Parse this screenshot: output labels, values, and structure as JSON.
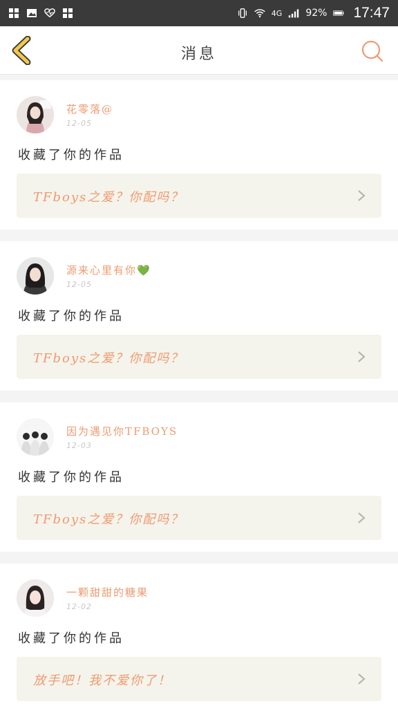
{
  "status_bar": {
    "network": "4G",
    "battery": "92%",
    "time": "17:47"
  },
  "header": {
    "title": "消息"
  },
  "colors": {
    "accent": "#ef9a6f",
    "back_arrow": "#f2c94c",
    "box_bg": "#f4f4ec"
  },
  "messages": [
    {
      "username": "花零落@",
      "date": "12-05",
      "action": "收藏了你的作品",
      "work_title": "TFboys之爱？你配吗？"
    },
    {
      "username": "源来心里有你💚",
      "date": "12-05",
      "action": "收藏了你的作品",
      "work_title": "TFboys之爱？你配吗？"
    },
    {
      "username": "因为遇见你TFBOYS",
      "date": "12-03",
      "action": "收藏了你的作品",
      "work_title": "TFboys之爱？你配吗？"
    },
    {
      "username": "一颗甜甜的糖果",
      "date": "12-02",
      "action": "收藏了你的作品",
      "work_title": "放手吧！我不爱你了！"
    }
  ]
}
